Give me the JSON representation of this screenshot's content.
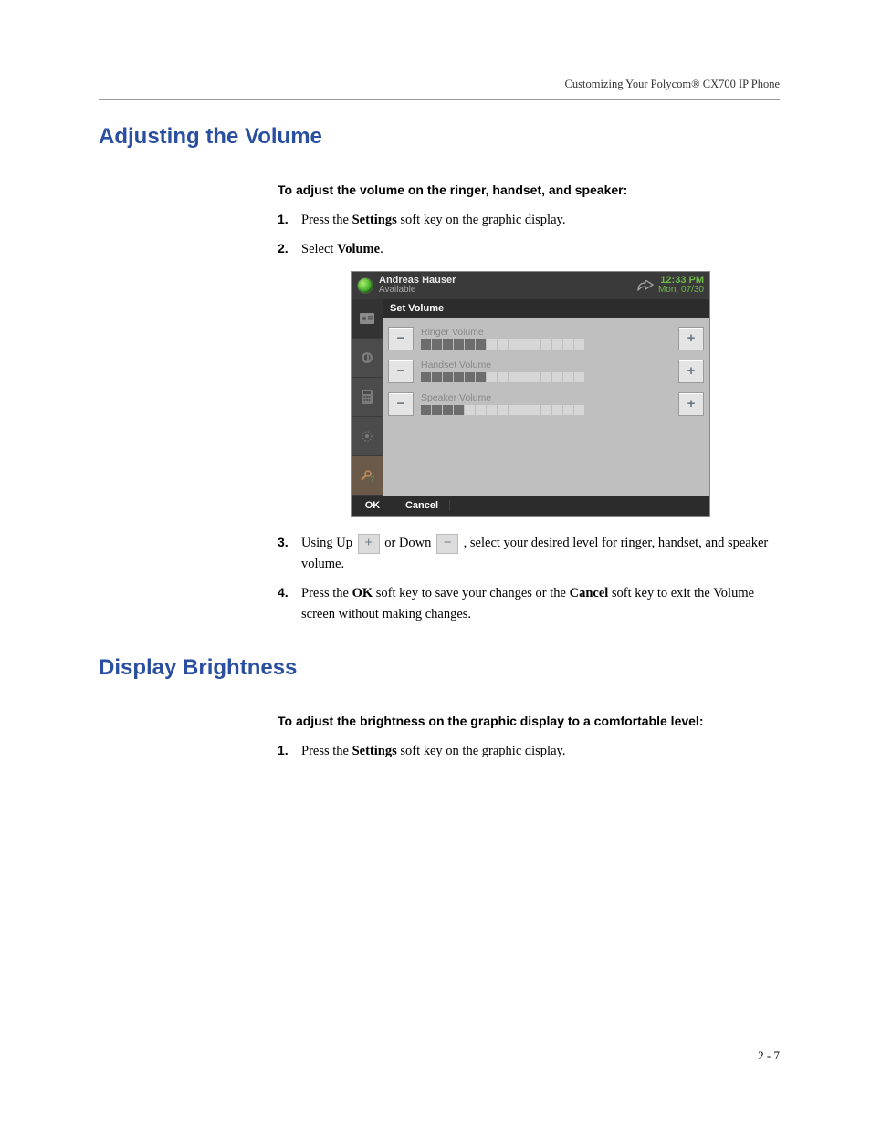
{
  "running_header": "Customizing Your Polycom® CX700 IP Phone",
  "sections": {
    "volume": {
      "heading": "Adjusting the Volume",
      "intro": "To adjust the volume on the ringer, handset, and speaker:",
      "steps": {
        "s1": {
          "num": "1.",
          "pre": "Press the ",
          "b1": "Settings",
          "post": " soft key on the graphic display."
        },
        "s2": {
          "num": "2.",
          "pre": "Select ",
          "b1": "Volume",
          "post": "."
        },
        "s3": {
          "num": "3.",
          "pre": "Using Up ",
          "mid": " or Down ",
          "post": " , select your desired level for ringer, handset, and speaker volume."
        },
        "s4": {
          "num": "4.",
          "pre": "Press the ",
          "b1": "OK",
          "mid": " soft key to save your changes or the ",
          "b2": "Cancel",
          "post": " soft key to exit the Volume screen without making changes."
        }
      }
    },
    "brightness": {
      "heading": "Display Brightness",
      "intro": "To adjust the brightness on the graphic display to a comfortable level:",
      "steps": {
        "s1": {
          "num": "1.",
          "pre": "Press the ",
          "b1": "Settings",
          "post": " soft key on the graphic display."
        }
      }
    }
  },
  "screenshot": {
    "user_name": "Andreas Hauser",
    "user_status": "Available",
    "time": "12:33 PM",
    "date": "Mon, 07/30",
    "panel_title": "Set Volume",
    "rows": {
      "ringer": {
        "label": "Ringer Volume",
        "filled": 6,
        "total": 15
      },
      "handset": {
        "label": "Handset Volume",
        "filled": 6,
        "total": 15
      },
      "speaker": {
        "label": "Speaker Volume",
        "filled": 4,
        "total": 15
      }
    },
    "softkeys": {
      "ok": "OK",
      "cancel": "Cancel"
    },
    "plus": "+",
    "minus": "−"
  },
  "inline_buttons": {
    "plus": "+",
    "minus": "−"
  },
  "page_number": "2 - 7"
}
